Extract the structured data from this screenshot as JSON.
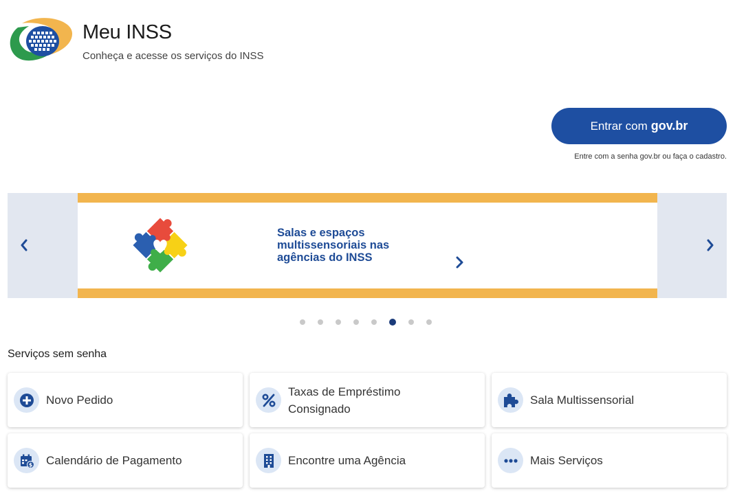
{
  "header": {
    "title": "Meu INSS",
    "subtitle": "Conheça e acesse os serviços do INSS",
    "logo_icon": "inss-logo"
  },
  "login": {
    "label": "Entrar com",
    "label_bold": "gov.br",
    "hint": "Entre com a senha gov.br ou faça o cadastro."
  },
  "carousel": {
    "prev_icon": "chevron-left-icon",
    "next_icon": "chevron-right-icon",
    "slide": {
      "text": "Salas e espaços multissensoriais nas agências do INSS",
      "image_icon": "puzzle-heart-icon",
      "arrow_icon": "chevron-right-icon"
    },
    "dot_count": 8,
    "active_index": 5
  },
  "services": {
    "title": "Serviços sem senha",
    "items": [
      {
        "label": "Novo Pedido",
        "icon": "plus-circle-icon"
      },
      {
        "label": "Taxas de Empréstimo Consignado",
        "icon": "percent-icon"
      },
      {
        "label": "Sala Multissensorial",
        "icon": "puzzle-icon"
      },
      {
        "label": "Calendário de Pagamento",
        "icon": "calendar-money-icon"
      },
      {
        "label": "Encontre uma Agência",
        "icon": "building-icon"
      },
      {
        "label": "Mais Serviços",
        "icon": "more-dots-icon"
      }
    ]
  },
  "colors": {
    "primary": "#1e4fa2",
    "accent": "#f2b54e",
    "icon_bg": "#dbe6f5",
    "carousel_bg": "#e2e7f0"
  }
}
